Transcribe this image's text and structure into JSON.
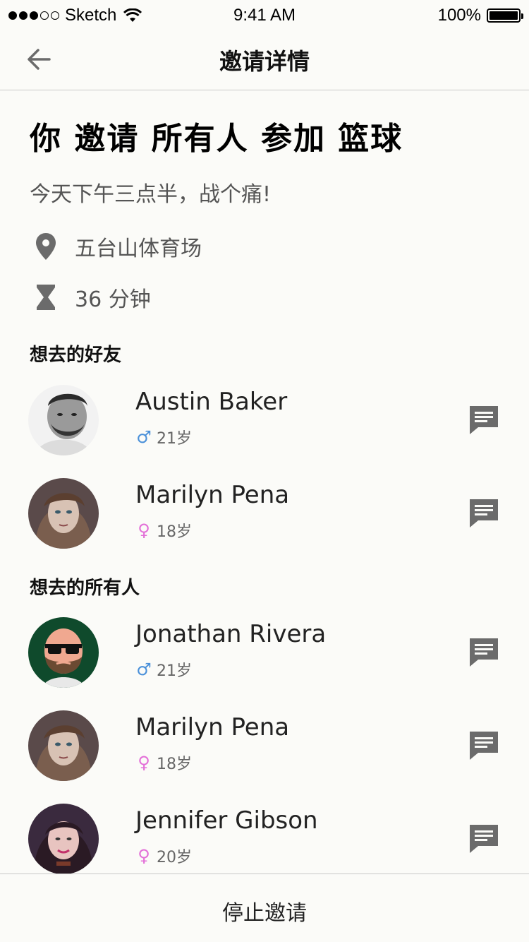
{
  "status_bar": {
    "carrier": "Sketch",
    "time": "9:41 AM",
    "battery": "100%"
  },
  "nav": {
    "title": "邀请详情",
    "back_icon": "arrow-left-icon"
  },
  "event": {
    "title": "你 邀请 所有人 参加 篮球",
    "description": "今天下午三点半，战个痛!",
    "location": "五台山体育场",
    "duration": "36 分钟"
  },
  "sections": {
    "friends_header": "想去的好友",
    "all_header": "想去的所有人"
  },
  "friends": [
    {
      "name": "Austin Baker",
      "gender": "♂",
      "age": "21岁"
    },
    {
      "name": "Marilyn Pena",
      "gender": "♀",
      "age": "18岁"
    }
  ],
  "everyone": [
    {
      "name": "Jonathan Rivera",
      "gender": "♂",
      "age": "21岁"
    },
    {
      "name": "Marilyn Pena",
      "gender": "♀",
      "age": "18岁"
    },
    {
      "name": "Jennifer Gibson",
      "gender": "♀",
      "age": "20岁"
    }
  ],
  "footer": {
    "stop_label": "停止邀请"
  },
  "colors": {
    "male": "#4a90d9",
    "female": "#e36fd8",
    "icon_gray": "#6b6b6b",
    "background": "#fbfbf8"
  }
}
